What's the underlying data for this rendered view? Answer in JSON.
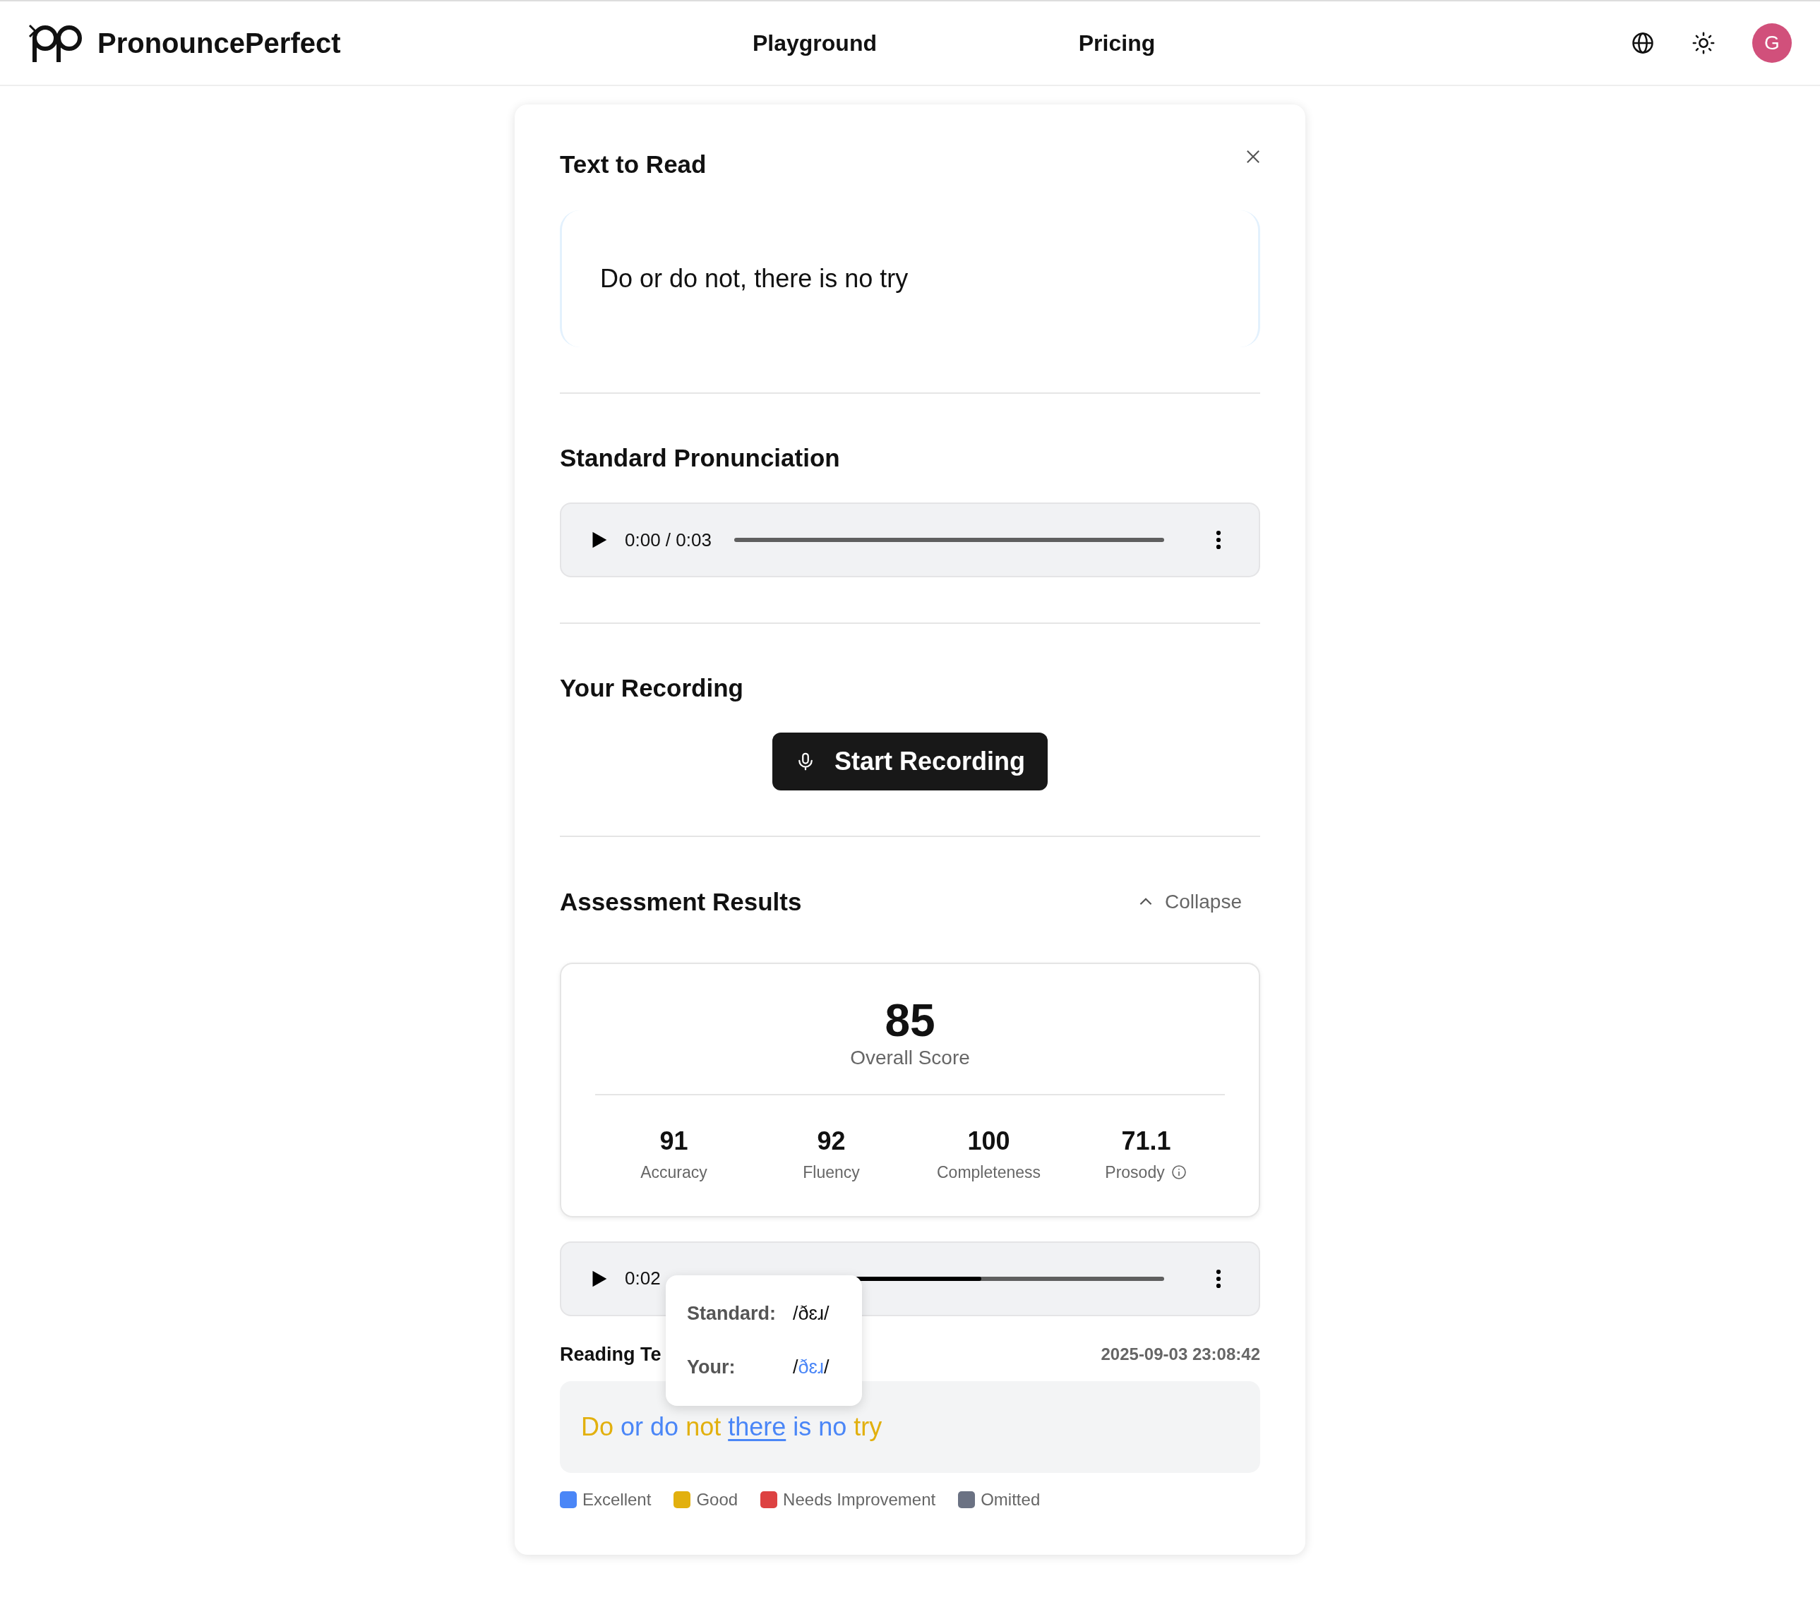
{
  "header": {
    "brand": "PronouncePerfect",
    "nav": [
      {
        "label": "Playground"
      },
      {
        "label": "Pricing"
      }
    ],
    "avatar": {
      "initial": "G",
      "color": "#d1507b"
    }
  },
  "text_to_read": {
    "title": "Text to Read",
    "text": "Do or do not, there is no try"
  },
  "standard_pronunciation": {
    "title": "Standard Pronunciation",
    "player": {
      "time": "0:00 / 0:03",
      "level": 0
    }
  },
  "your_recording": {
    "title": "Your Recording",
    "button": "Start Recording"
  },
  "assessment": {
    "title": "Assessment Results",
    "collapse": "Collapse",
    "expanded": true,
    "overall": {
      "value": "85",
      "label": "Overall Score"
    },
    "scores": [
      {
        "value": "91",
        "label": "Accuracy",
        "info": false
      },
      {
        "value": "92",
        "label": "Fluency",
        "info": false
      },
      {
        "value": "100",
        "label": "Completeness",
        "info": false
      },
      {
        "value": "71.1",
        "label": "Prosody",
        "info": true
      }
    ],
    "player": {
      "time": "0:02",
      "level": 0.62
    },
    "reading_label": "Reading Te",
    "timestamp": "2025-09-03 23:08:42",
    "words": [
      {
        "text": "Do",
        "color": "#e2b00e",
        "selected": false
      },
      {
        "text": "or",
        "color": "#4a86f7",
        "selected": false
      },
      {
        "text": "do",
        "color": "#4a86f7",
        "selected": false
      },
      {
        "text": "not",
        "color": "#e2b00e",
        "selected": false
      },
      {
        "text": "there",
        "color": "#4a86f7",
        "selected": true
      },
      {
        "text": "is",
        "color": "#4a86f7",
        "selected": false
      },
      {
        "text": "no",
        "color": "#4a86f7",
        "selected": false
      },
      {
        "text": "try",
        "color": "#e2b00e",
        "selected": false
      }
    ],
    "tooltip": {
      "standard_label": "Standard:",
      "standard": "/ðɛɹ/",
      "your_label": "Your:",
      "your": [
        {
          "text": "/",
          "color": "#111111"
        },
        {
          "text": "ðɛɹ",
          "color": "#4a86f7"
        },
        {
          "text": "/",
          "color": "#111111"
        }
      ]
    },
    "legend": [
      {
        "label": "Excellent",
        "color": "#4a86f7"
      },
      {
        "label": "Good",
        "color": "#e2b00e"
      },
      {
        "label": "Needs Improvement",
        "color": "#dd4242"
      },
      {
        "label": "Omitted",
        "color": "#6b7283"
      }
    ]
  }
}
